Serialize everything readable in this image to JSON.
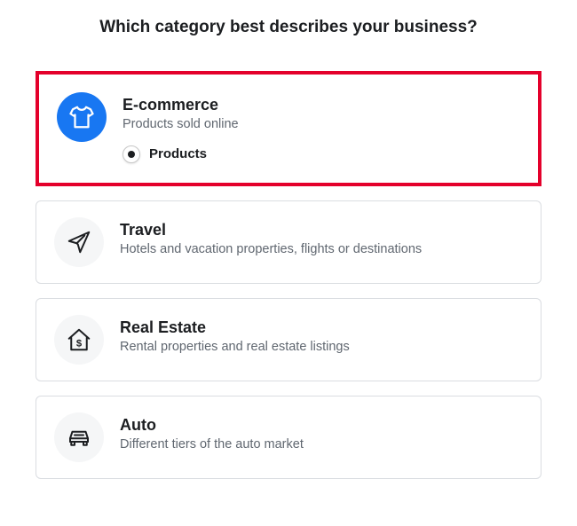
{
  "title": "Which category best describes your business?",
  "categories": [
    {
      "id": "ecommerce",
      "title": "E-commerce",
      "desc": "Products sold online",
      "selected": true,
      "sub": {
        "label": "Products"
      }
    },
    {
      "id": "travel",
      "title": "Travel",
      "desc": "Hotels and vacation properties, flights or destinations"
    },
    {
      "id": "realestate",
      "title": "Real Estate",
      "desc": "Rental properties and real estate listings"
    },
    {
      "id": "auto",
      "title": "Auto",
      "desc": "Different tiers of the auto market"
    }
  ]
}
